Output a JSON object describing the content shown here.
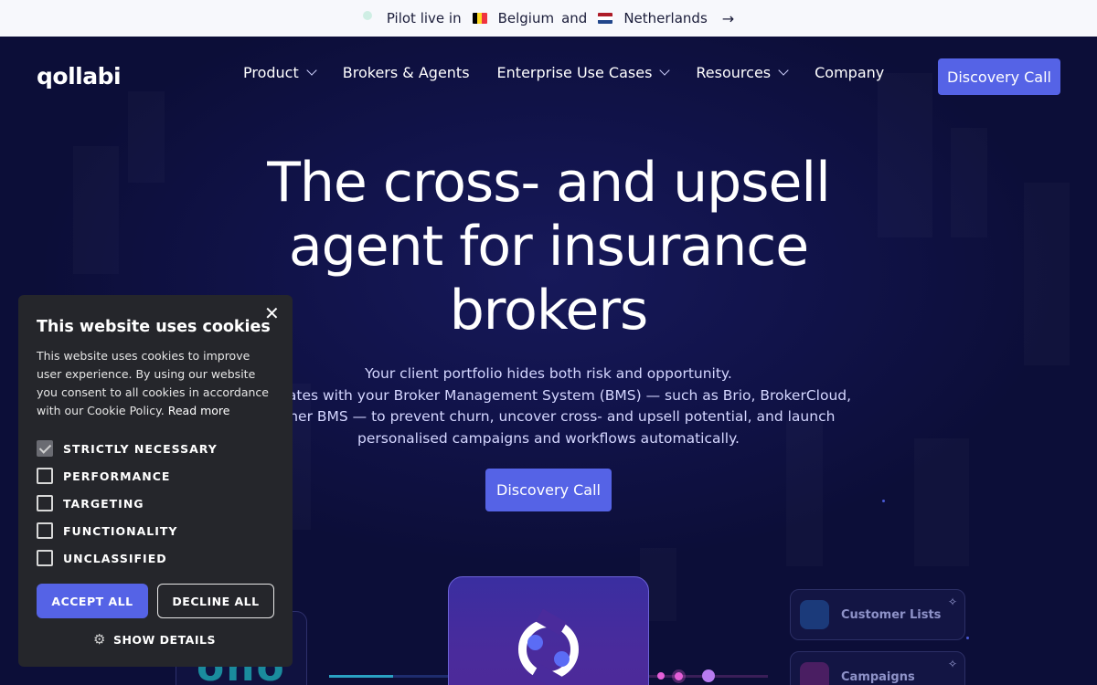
{
  "announcement": {
    "prefix": "Pilot live in",
    "country1": "Belgium",
    "joiner": "and",
    "country2": "Netherlands"
  },
  "nav": {
    "logo": "qollabi",
    "links": [
      "Product",
      "Brokers & Agents",
      "Enterprise Use Cases",
      "Resources",
      "Company"
    ],
    "cta": "Discovery Call"
  },
  "hero": {
    "headline": "The cross- and upsell agent for insurance brokers",
    "lines": [
      "Your client portfolio hides both risk and opportunity.",
      "integrates with your Broker Management System (BMS) — such as Brio, BrokerCloud,",
      "y other BMS — to prevent churn, uncover cross- and upsell potential, and launch",
      "personalised campaigns and workflows automatically."
    ],
    "cta": "Discovery Call"
  },
  "graphics": {
    "left_card_text": "ono",
    "cards": [
      "Customer Lists",
      "Campaigns"
    ]
  },
  "cookie": {
    "title": "This website uses cookies",
    "text": "This website uses cookies to improve user experience. By using our website you consent to all cookies in accordance with our Cookie Policy.",
    "read_more": "Read more",
    "options": [
      {
        "label": "STRICTLY NECESSARY",
        "checked": true
      },
      {
        "label": "PERFORMANCE",
        "checked": false
      },
      {
        "label": "TARGETING",
        "checked": false
      },
      {
        "label": "FUNCTIONALITY",
        "checked": false
      },
      {
        "label": "UNCLASSIFIED",
        "checked": false
      }
    ],
    "accept": "ACCEPT ALL",
    "decline": "DECLINE ALL",
    "details": "SHOW DETAILS"
  },
  "colors": {
    "accent": "#5563e6",
    "hero_bg": "#0d0f3a",
    "cookie_bg": "#25262b"
  }
}
